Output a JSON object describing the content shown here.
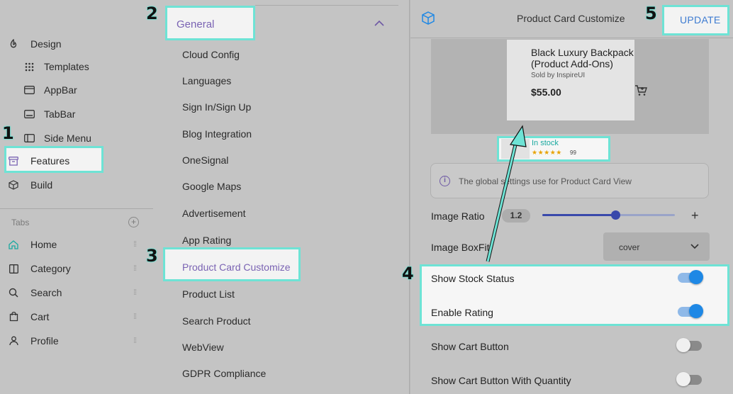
{
  "sidebar": {
    "items": [
      {
        "label": "Design",
        "icon": "palette-icon"
      },
      {
        "label": "Templates",
        "icon": "grid-dots-icon"
      },
      {
        "label": "AppBar",
        "icon": "appbar-icon"
      },
      {
        "label": "TabBar",
        "icon": "tabbar-icon"
      },
      {
        "label": "Side Menu",
        "icon": "side-menu-icon"
      },
      {
        "label": "Features",
        "icon": "archive-icon"
      },
      {
        "label": "Build",
        "icon": "cube-icon"
      }
    ],
    "tabs_label": "Tabs",
    "tabs": [
      {
        "label": "Home",
        "icon": "home-icon"
      },
      {
        "label": "Category",
        "icon": "category-icon"
      },
      {
        "label": "Search",
        "icon": "search-icon"
      },
      {
        "label": "Cart",
        "icon": "cart-icon"
      },
      {
        "label": "Profile",
        "icon": "person-icon"
      }
    ]
  },
  "menu": {
    "section": "General",
    "items": [
      "Cloud Config",
      "Languages",
      "Sign In/Sign Up",
      "Blog Integration",
      "OneSignal",
      "Google Maps",
      "Advertisement",
      "App Rating",
      "Product Card Customize",
      "Product List",
      "Search Product",
      "WebView",
      "GDPR Compliance"
    ]
  },
  "panel": {
    "title": "Product Card Customize",
    "update_label": "UPDATE",
    "preview": {
      "product_name": "Black Luxury Backpack (Product Add-Ons)",
      "sold_by": "Sold by InspireUI",
      "price": "$55.00",
      "stock": "In stock",
      "stars": "★★★★★",
      "rating_count": "99"
    },
    "info": "The global settings use for Product Card View",
    "image_ratio_label": "Image Ratio",
    "image_ratio_value": "1.2",
    "image_ratio_slider": 0.55,
    "image_boxfit_label": "Image BoxFit",
    "image_boxfit_value": "cover",
    "toggles": [
      {
        "label": "Show Stock Status",
        "on": true
      },
      {
        "label": "Enable Rating",
        "on": true
      },
      {
        "label": "Show Cart Button",
        "on": false
      },
      {
        "label": "Show Cart Button With Quantity",
        "on": false
      }
    ]
  },
  "annotations": {
    "step1": "1",
    "step2": "2",
    "step3": "3",
    "step4": "4",
    "step5": "5",
    "highlight_color": "#6ee3d5"
  },
  "colors": {
    "accent_purple": "#7a63b3",
    "accent_blue": "#1e88e5",
    "update_blue": "#3d7bd1"
  }
}
